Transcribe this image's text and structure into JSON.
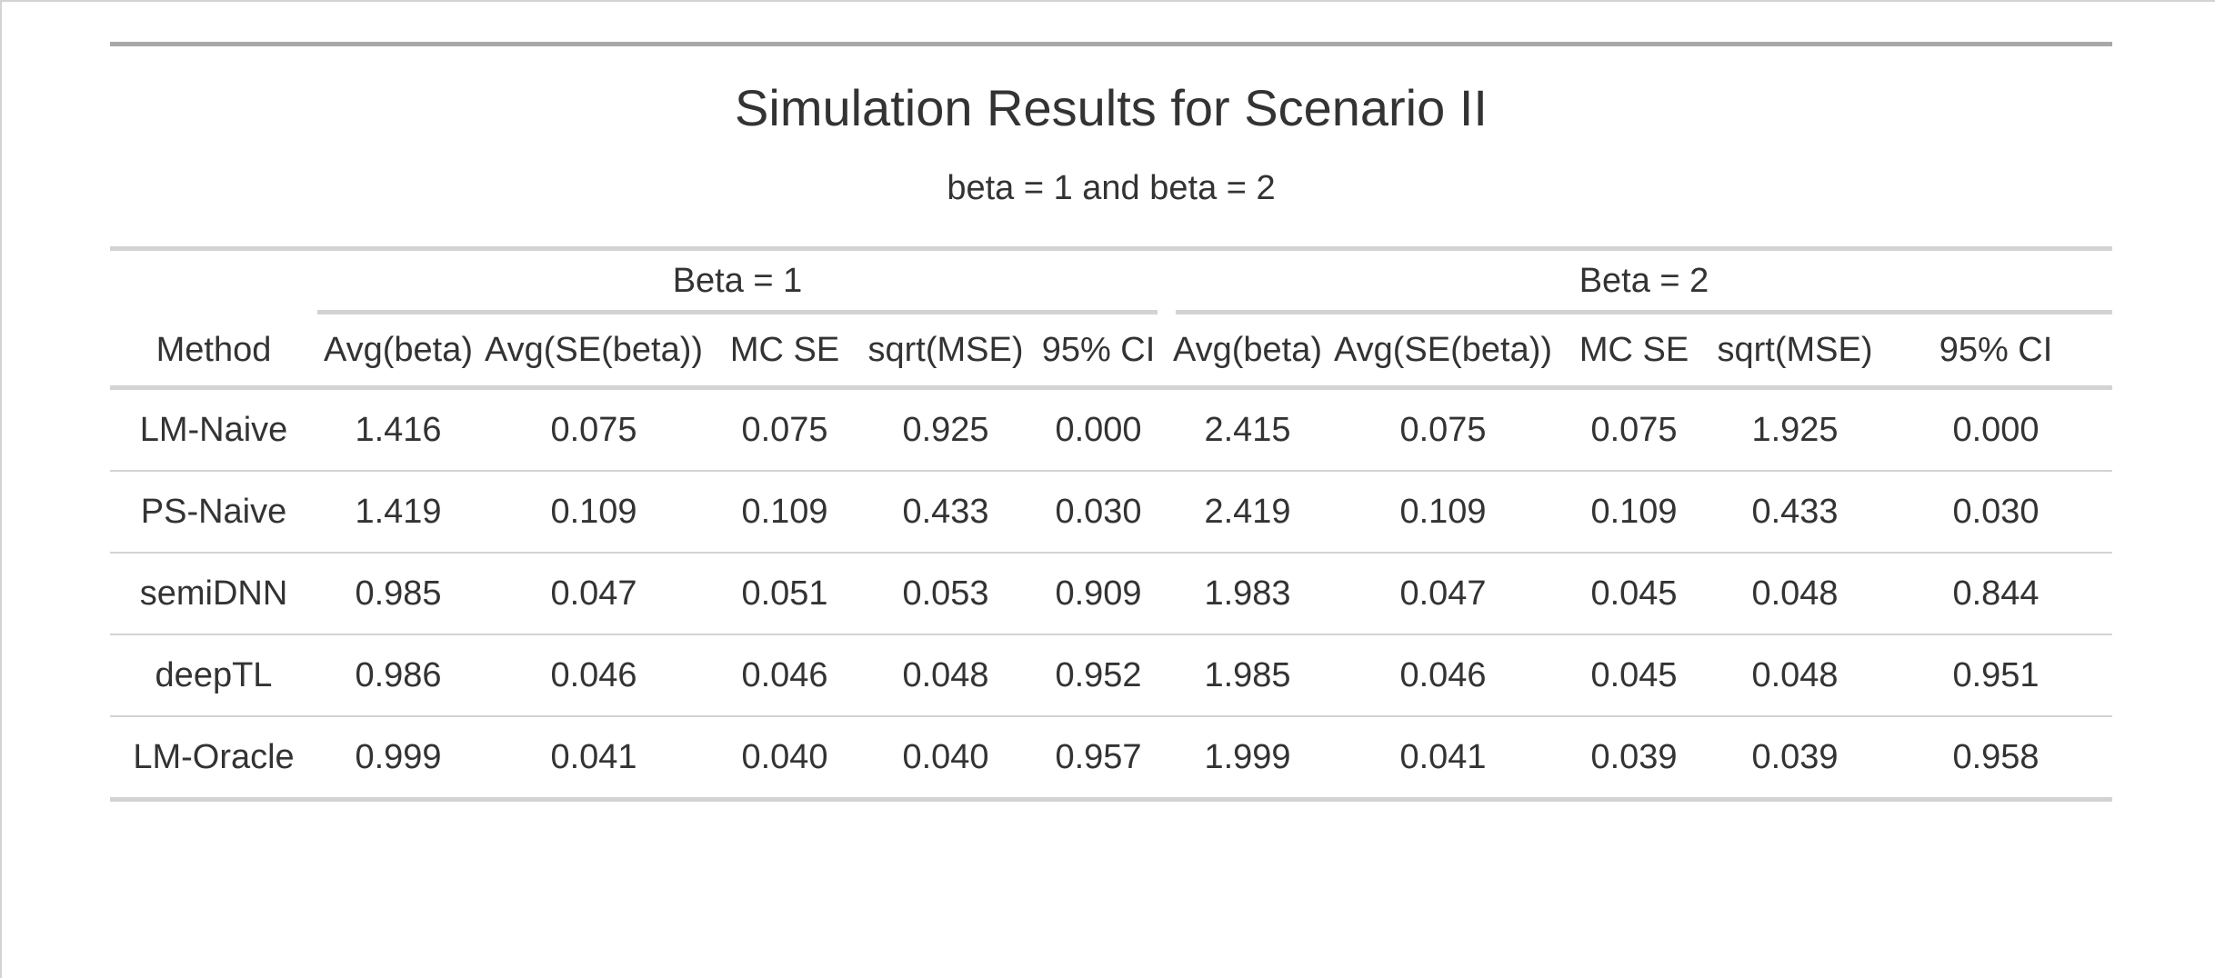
{
  "table": {
    "title": "Simulation Results for Scenario II",
    "subtitle": "beta = 1 and beta = 2",
    "spanners": [
      "Beta = 1",
      "Beta = 2"
    ],
    "columns": [
      "Method",
      "Avg(beta)",
      "Avg(SE(beta))",
      "MC SE",
      "sqrt(MSE)",
      "95% CI",
      "Avg(beta)",
      "Avg(SE(beta))",
      "MC SE",
      "sqrt(MSE)",
      "95% CI"
    ],
    "rows": [
      [
        "LM-Naive",
        "1.416",
        "0.075",
        "0.075",
        "0.925",
        "0.000",
        "2.415",
        "0.075",
        "0.075",
        "1.925",
        "0.000"
      ],
      [
        "PS-Naive",
        "1.419",
        "0.109",
        "0.109",
        "0.433",
        "0.030",
        "2.419",
        "0.109",
        "0.109",
        "0.433",
        "0.030"
      ],
      [
        "semiDNN",
        "0.985",
        "0.047",
        "0.051",
        "0.053",
        "0.909",
        "1.983",
        "0.047",
        "0.045",
        "0.048",
        "0.844"
      ],
      [
        "deepTL",
        "0.986",
        "0.046",
        "0.046",
        "0.048",
        "0.952",
        "1.985",
        "0.046",
        "0.045",
        "0.048",
        "0.951"
      ],
      [
        "LM-Oracle",
        "0.999",
        "0.041",
        "0.040",
        "0.040",
        "0.957",
        "1.999",
        "0.041",
        "0.039",
        "0.039",
        "0.958"
      ]
    ]
  }
}
